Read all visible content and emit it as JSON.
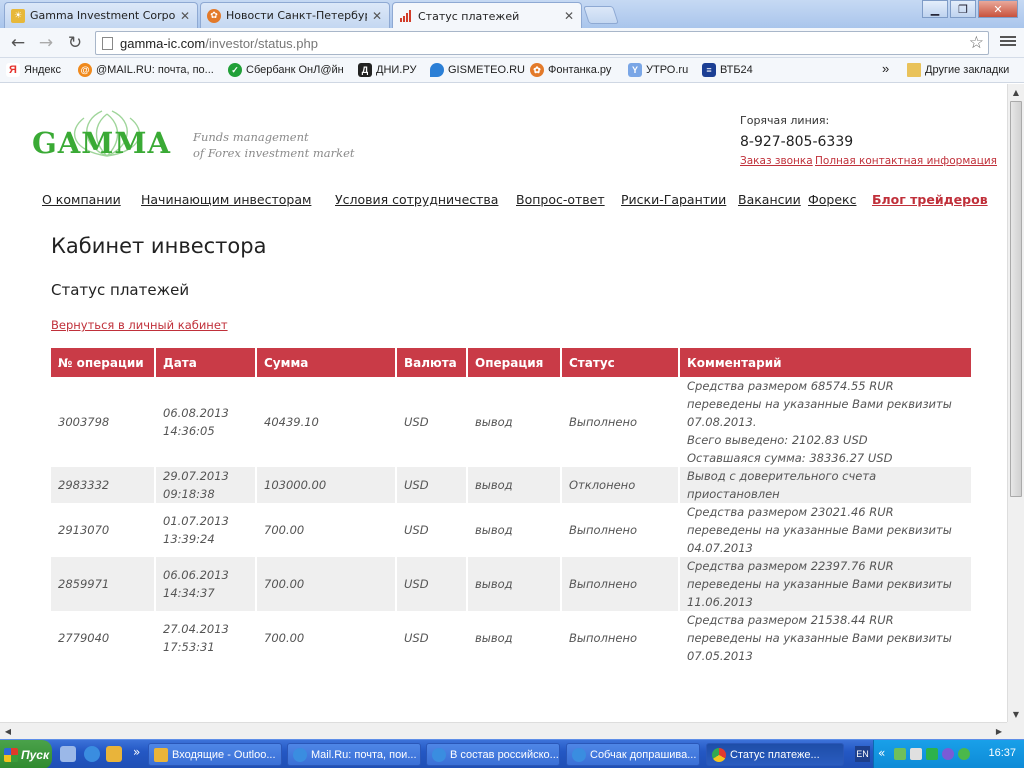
{
  "browser": {
    "tabs": [
      {
        "label": "Gamma Investment Corporat",
        "icon": "gamma-favicon",
        "color": "#e7b83a"
      },
      {
        "label": "Новости Санкт-Петербурга",
        "icon": "fontanka-favicon",
        "color": "#e37a2a"
      },
      {
        "label": "Статус платежей",
        "icon": "bar-chart-favicon",
        "color": "#d23d2a"
      }
    ],
    "url_host": "gamma-ic.com",
    "url_path": "/investor/status.php",
    "bookmarks": [
      {
        "label": "Яндекс",
        "icon": "yandex-icon",
        "color": "#e5322d"
      },
      {
        "label": "@MAIL.RU: почта, по...",
        "icon": "mailru-icon",
        "color": "#f08a1d"
      },
      {
        "label": "Сбербанк ОнЛ@йн",
        "icon": "sberbank-icon",
        "color": "#21a038"
      },
      {
        "label": "ДНИ.РУ",
        "icon": "dni-icon",
        "color": "#222222"
      },
      {
        "label": "GISMETEO.RU",
        "icon": "gismeteo-icon",
        "color": "#2b7fd6"
      },
      {
        "label": "Фонтанка.ру",
        "icon": "fontanka-icon",
        "color": "#e37a2a"
      },
      {
        "label": "УТРО.ru",
        "icon": "utro-icon",
        "color": "#7aa6e6"
      },
      {
        "label": "ВТБ24",
        "icon": "vtb-icon",
        "color": "#1c3f94"
      }
    ],
    "more_label": "»",
    "other_bookmarks": "Другие закладки"
  },
  "site": {
    "logo_text": "GAMMA",
    "tagline_1": "Funds management",
    "tagline_2": "of Forex investment market",
    "hotline_label": "Горячая линия:",
    "hotline_phone": "8-927-805-6339",
    "order_call": "Заказ звонка",
    "full_contacts": "Полная контактная информация",
    "nav": [
      "О компании",
      "Начинающим инвесторам",
      "Условия сотрудничества",
      "Вопрос-ответ",
      "Риски-Гарантии",
      "Вакансии",
      "Форекс",
      "Блог трейдеров"
    ],
    "accent_color": "#c93b47",
    "logo_color": "#3aaa35"
  },
  "page": {
    "title": "Кабинет инвестора",
    "subtitle": "Статус платежей",
    "back_link": "Вернуться в личный кабинет"
  },
  "table": {
    "headers": [
      "№ операции",
      "Дата",
      "Сумма",
      "Валюта",
      "Операция",
      "Статус",
      "Комментарий"
    ],
    "rows": [
      {
        "id": "3003798",
        "date": "06.08.2013",
        "time": "14:36:05",
        "amount": "40439.10",
        "currency": "USD",
        "operation": "вывод",
        "status": "Выполнено",
        "comment": [
          "Средства размером 68574.55 RUR",
          "переведены на указанные Вами реквизиты",
          "07.08.2013.",
          "Всего выведено: 2102.83 USD",
          "Оставшаяся сумма: 38336.27 USD"
        ]
      },
      {
        "id": "2983332",
        "date": "29.07.2013",
        "time": "09:18:38",
        "amount": "103000.00",
        "currency": "USD",
        "operation": "вывод",
        "status": "Отклонено",
        "comment": [
          "Вывод с доверительного счета",
          "приостановлен"
        ]
      },
      {
        "id": "2913070",
        "date": "01.07.2013",
        "time": "13:39:24",
        "amount": "700.00",
        "currency": "USD",
        "operation": "вывод",
        "status": "Выполнено",
        "comment": [
          "Средства размером 23021.46 RUR",
          "переведены на указанные Вами реквизиты",
          "04.07.2013"
        ]
      },
      {
        "id": "2859971",
        "date": "06.06.2013",
        "time": "14:34:37",
        "amount": "700.00",
        "currency": "USD",
        "operation": "вывод",
        "status": "Выполнено",
        "comment": [
          "Средства размером 22397.76 RUR",
          "переведены на указанные Вами реквизиты",
          "11.06.2013"
        ]
      },
      {
        "id": "2779040",
        "date": "27.04.2013",
        "time": "17:53:31",
        "amount": "700.00",
        "currency": "USD",
        "operation": "вывод",
        "status": "Выполнено",
        "comment": [
          "Средства размером 21538.44 RUR",
          "переведены на указанные Вами реквизиты",
          "07.05.2013"
        ]
      }
    ]
  },
  "taskbar": {
    "start_label": "Пуск",
    "tasks": [
      {
        "label": "Входящие - Outloo..."
      },
      {
        "label": "Mail.Ru: почта, пои..."
      },
      {
        "label": "В состав российско..."
      },
      {
        "label": "Собчак допрашива..."
      },
      {
        "label": "Статус платеже..."
      }
    ],
    "lang": "EN",
    "more_label": "«",
    "clock": "16:37"
  }
}
